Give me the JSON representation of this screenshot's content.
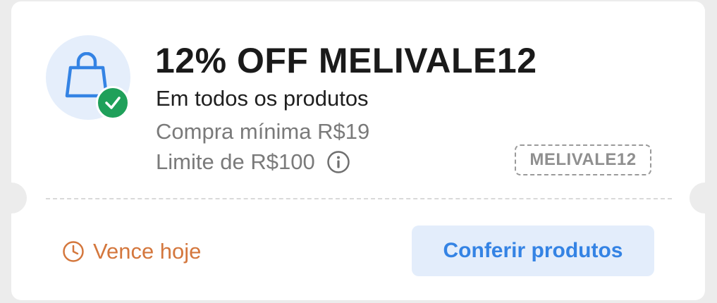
{
  "coupon": {
    "title": "12% OFF MELIVALE12",
    "scope": "Em todos os produtos",
    "min_purchase": "Compra mínima R$19",
    "limit": "Limite de R$100",
    "code": "MELIVALE12",
    "expiry": "Vence hoje",
    "cta_label": "Conferir produtos"
  },
  "icons": {
    "main": "shopping-bag-icon",
    "badge": "checkmark-icon",
    "info": "info-icon",
    "expiry": "clock-icon"
  },
  "colors": {
    "primary_blue": "#3483e4",
    "success_green": "#1fa05a",
    "expiry_orange": "#d4773d",
    "muted_text": "#7a7a7a"
  }
}
